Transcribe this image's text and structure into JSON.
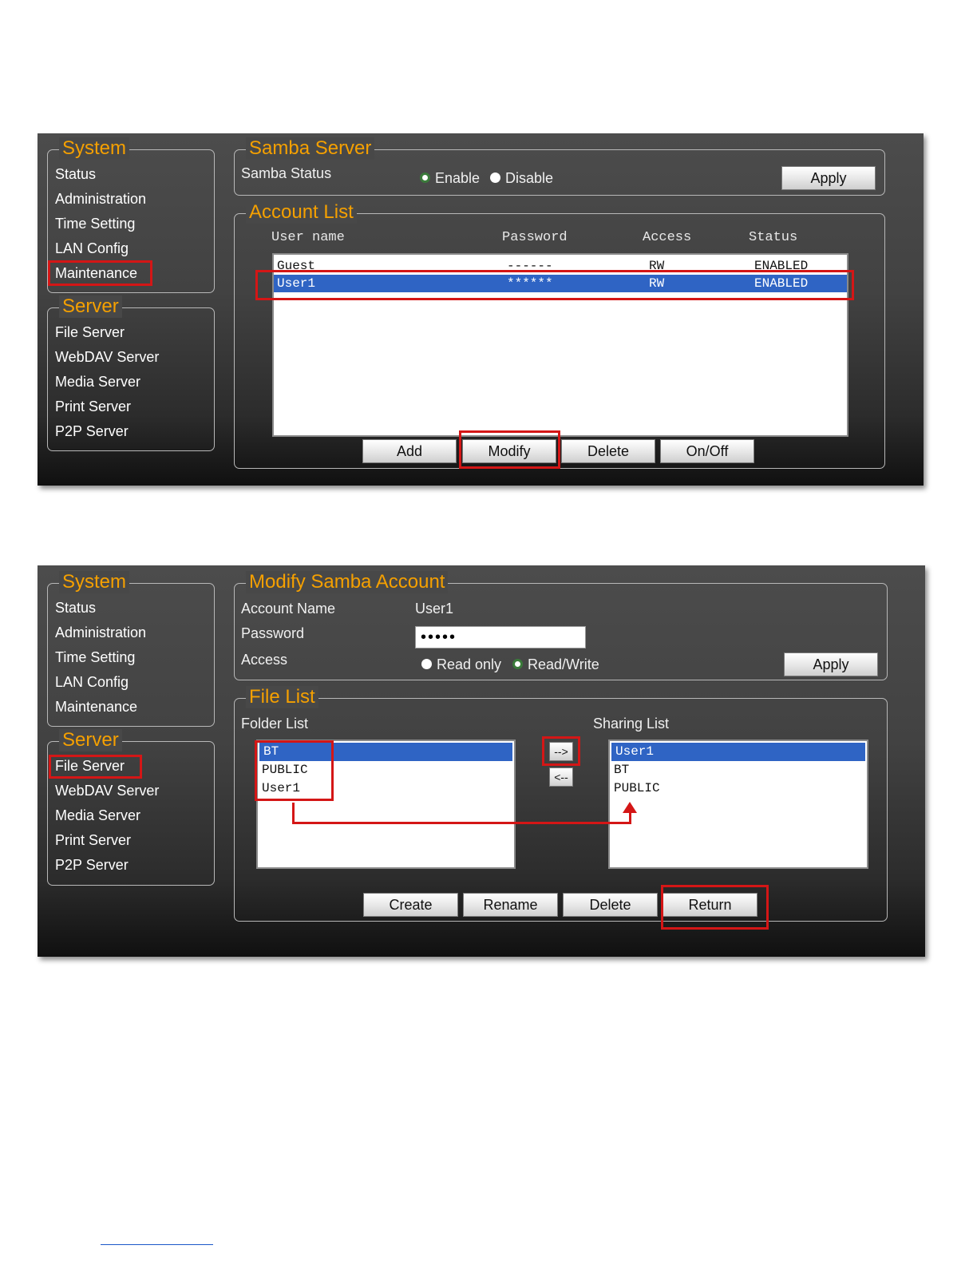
{
  "screen1": {
    "system": {
      "title": "System",
      "items": [
        "Status",
        "Administration",
        "Time Setting",
        "LAN Config",
        "Maintenance"
      ]
    },
    "server": {
      "title": "Server",
      "items": [
        "File Server",
        "WebDAV Server",
        "Media Server",
        "Print Server",
        "P2P Server"
      ]
    },
    "samba": {
      "title": "Samba Server",
      "status_label": "Samba Status",
      "enable_label": "Enable",
      "disable_label": "Disable",
      "selected": "Enable",
      "apply_label": "Apply"
    },
    "accounts": {
      "title": "Account List",
      "headers": {
        "user": "User name",
        "password": "Password",
        "access": "Access",
        "status": "Status"
      },
      "rows": [
        {
          "user": "Guest",
          "password": "------",
          "access": "RW",
          "status": "ENABLED",
          "selected": false
        },
        {
          "user": "User1",
          "password": "******",
          "access": "RW",
          "status": "ENABLED",
          "selected": true
        }
      ],
      "buttons": {
        "add": "Add",
        "modify": "Modify",
        "delete": "Delete",
        "onoff": "On/Off"
      }
    }
  },
  "screen2": {
    "system": {
      "title": "System",
      "items": [
        "Status",
        "Administration",
        "Time Setting",
        "LAN Config",
        "Maintenance"
      ]
    },
    "server": {
      "title": "Server",
      "items": [
        "File Server",
        "WebDAV Server",
        "Media Server",
        "Print Server",
        "P2P Server"
      ]
    },
    "modify": {
      "title": "Modify Samba Account",
      "account_name_label": "Account Name",
      "account_name_value": "User1",
      "password_label": "Password",
      "password_value": "•••••",
      "access_label": "Access",
      "read_only_label": "Read only",
      "read_write_label": "Read/Write",
      "selected_access": "Read/Write",
      "apply_label": "Apply"
    },
    "files": {
      "title": "File List",
      "folder_list_label": "Folder List",
      "sharing_list_label": "Sharing List",
      "folders": [
        "BT",
        "PUBLIC",
        "User1"
      ],
      "sharing": [
        "User1",
        "BT",
        "PUBLIC"
      ],
      "add_arrow_label": "-->",
      "remove_arrow_label": "<--",
      "buttons": {
        "create": "Create",
        "rename": "Rename",
        "delete": "Delete",
        "return": "Return"
      }
    }
  },
  "colors": {
    "legend": "#f5a000",
    "selection": "#2f64c4",
    "highlight": "#d41616"
  }
}
